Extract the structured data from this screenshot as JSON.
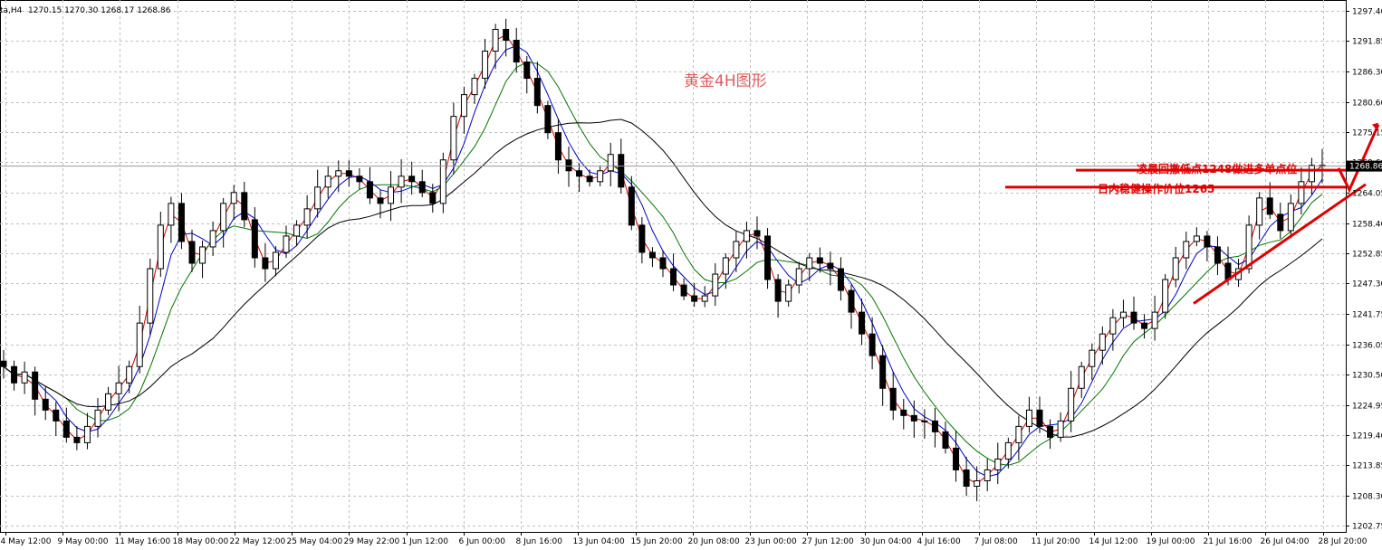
{
  "header": {
    "symbol": "ta,H4",
    "ohlc": "1270.15 1270.30 1268.17 1268.86"
  },
  "chart_data": {
    "type": "candlestick",
    "title": "黄金4H图形",
    "y_ticks": [
      "1297.40",
      "1291.85",
      "1286.30",
      "1280.60",
      "1275.15",
      "1269.60",
      "1264.05",
      "1258.40",
      "1252.85",
      "1247.30",
      "1241.75",
      "1236.05",
      "1230.50",
      "1224.95",
      "1219.40",
      "1213.85",
      "1208.30",
      "1202.75"
    ],
    "y_tick_values": [
      1297.4,
      1291.85,
      1286.3,
      1280.6,
      1275.15,
      1269.6,
      1264.05,
      1258.4,
      1252.85,
      1247.3,
      1241.75,
      1236.05,
      1230.5,
      1224.95,
      1219.4,
      1213.85,
      1208.3,
      1202.75
    ],
    "ylim": [
      1201.6,
      1299.4
    ],
    "x_ticks": [
      "4 May 12:00",
      "9 May 00:00",
      "11 May 16:00",
      "18 May 00:00",
      "22 May 12:00",
      "25 May 04:00",
      "29 May 22:00",
      "1 Jun 12:00",
      "6 Jun 00:00",
      "8 Jun 16:00",
      "13 Jun 04:00",
      "15 Jun 20:00",
      "20 Jun 08:00",
      "23 Jun 00:00",
      "27 Jun 12:00",
      "30 Jun 04:00",
      "4 Jul 16:00",
      "7 Jul 08:00",
      "11 Jul 20:00",
      "14 Jul 12:00",
      "19 Jul 00:00",
      "21 Jul 16:00",
      "26 Jul 04:00",
      "28 Jul 20:00"
    ],
    "current_price": "1268.86",
    "current_value": 1268.86,
    "candles_close": [
      1232,
      1229,
      1231,
      1226,
      1224,
      1222,
      1219,
      1218,
      1221,
      1224,
      1227,
      1229,
      1232,
      1240,
      1250,
      1258,
      1262,
      1255,
      1251,
      1254,
      1257,
      1262,
      1264,
      1259,
      1252,
      1250,
      1253,
      1256,
      1258,
      1261,
      1265,
      1267,
      1268,
      1267,
      1266,
      1263,
      1262,
      1265,
      1267,
      1266,
      1264,
      1262,
      1270,
      1278,
      1282,
      1285,
      1290,
      1294,
      1292,
      1288,
      1285,
      1280,
      1275,
      1270,
      1268,
      1267,
      1266,
      1268,
      1271,
      1265,
      1258,
      1253,
      1252,
      1250,
      1247,
      1245,
      1244,
      1245,
      1249,
      1252,
      1255,
      1257,
      1256,
      1248,
      1244,
      1247,
      1250,
      1252,
      1251,
      1250,
      1246,
      1242,
      1238,
      1234,
      1228,
      1224,
      1223,
      1222,
      1222,
      1220,
      1217,
      1213,
      1210,
      1211,
      1213,
      1215,
      1218,
      1221,
      1224,
      1221,
      1219,
      1222,
      1228,
      1232,
      1235,
      1238,
      1241,
      1242,
      1240,
      1239,
      1242,
      1248,
      1252,
      1255,
      1256,
      1254,
      1251,
      1248,
      1250,
      1258,
      1263,
      1260,
      1257,
      1262,
      1266,
      1269,
      1268.86
    ],
    "annotations": [
      "凌晨回撤低点1248做进多单点位",
      "日内稳健操作价位1265"
    ],
    "hline_values": [
      1268.1,
      1265.0
    ],
    "colors": {
      "bull": "#000000",
      "bear": "#000000",
      "ma_fast": "#d40000",
      "ma_mid": "#0000cc",
      "ma_slow": "#007700",
      "ma_long": "#000000",
      "annotation": "#e00000",
      "grid": "#c0c0c0"
    },
    "grid": true,
    "ma_count": 4
  }
}
